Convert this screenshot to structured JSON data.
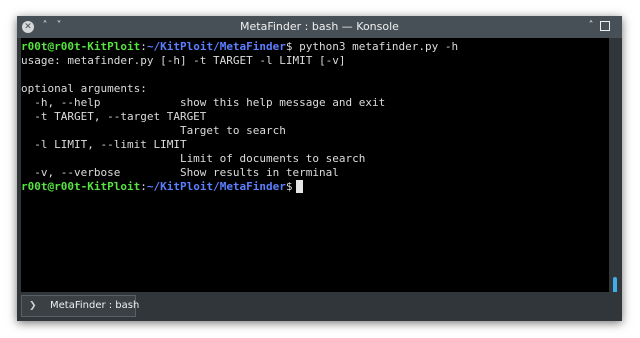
{
  "window": {
    "title": "MetaFinder : bash — Konsole",
    "close_glyph": "✕",
    "minimize_glyph": "˄",
    "menu_glyph": "˅",
    "keep_above_glyph": "˄"
  },
  "terminal": {
    "prompt": {
      "user_host": "r00t@r00t-KitPloit",
      "colon": ":",
      "path": "~/KitPloit/MetaFinder",
      "dollar": "$"
    },
    "command": " python3 metafinder.py -h",
    "output": [
      "usage: metafinder.py [-h] -t TARGET -l LIMIT [-v]",
      "",
      "optional arguments:",
      "  -h, --help            show this help message and exit",
      "  -t TARGET, --target TARGET",
      "                        Target to search",
      "  -l LIMIT, --limit LIMIT",
      "                        Limit of documents to search",
      "  -v, --verbose         Show results in terminal"
    ]
  },
  "scrollbar": {
    "position": 1.0
  },
  "tabs": [
    {
      "label": "MetaFinder : bash",
      "icon": "terminal-icon",
      "icon_glyph": "❯"
    }
  ],
  "colors": {
    "prompt_user": "#55e33f",
    "prompt_path": "#5c7fff",
    "text": "#dcdcdc",
    "background": "#000000",
    "accent": "#3daee9"
  }
}
